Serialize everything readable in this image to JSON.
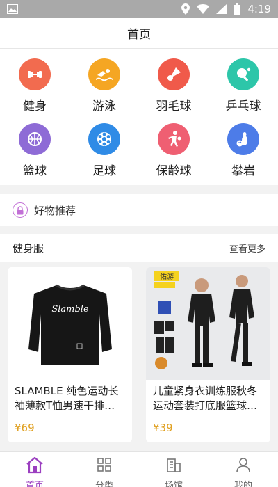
{
  "status_bar": {
    "time": "4:19"
  },
  "header": {
    "title": "首页"
  },
  "categories": [
    {
      "label": "健身",
      "icon": "dumbbell-icon",
      "color": "#f26b4f"
    },
    {
      "label": "游泳",
      "icon": "swimmer-icon",
      "color": "#f5a623"
    },
    {
      "label": "羽毛球",
      "icon": "shuttlecock-icon",
      "color": "#f05a4a"
    },
    {
      "label": "乒乓球",
      "icon": "pingpong-icon",
      "color": "#2dc6a9"
    },
    {
      "label": "篮球",
      "icon": "basketball-icon",
      "color": "#8e6bd6"
    },
    {
      "label": "足球",
      "icon": "football-icon",
      "color": "#2f8be6"
    },
    {
      "label": "保龄球",
      "icon": "bowling-player-icon",
      "color": "#ef5f72"
    },
    {
      "label": "攀岩",
      "icon": "bowling-pins-icon",
      "color": "#4d7ce8"
    }
  ],
  "recommend": {
    "label": "好物推荐"
  },
  "section": {
    "title": "健身服",
    "more": "查看更多"
  },
  "products": [
    {
      "title": "SLAMBLE 纯色运动长袖薄款T恤男速干排…",
      "price": "¥69",
      "image_text": "Slamble"
    },
    {
      "title": "儿童紧身衣训练服秋冬运动套装打底服篮球…",
      "price": "¥39",
      "image_text": "佑游"
    }
  ],
  "bottom_nav": [
    {
      "label": "首页",
      "icon": "home-icon",
      "active": true
    },
    {
      "label": "分类",
      "icon": "grid-icon",
      "active": false
    },
    {
      "label": "场馆",
      "icon": "building-icon",
      "active": false
    },
    {
      "label": "我的",
      "icon": "user-icon",
      "active": false
    }
  ],
  "colors": {
    "accent": "#9b3fc0",
    "price": "#e0a020"
  }
}
